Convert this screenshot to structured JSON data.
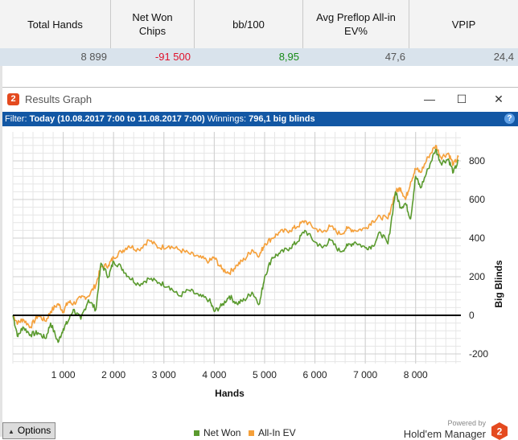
{
  "stats": {
    "headers": [
      "Total Hands",
      "Net Won\nChips",
      "bb/100",
      "Avg Preflop All-in\nEV%",
      "VPIP"
    ],
    "values": [
      "8 899",
      "-91 500",
      "8,95",
      "47,6",
      "24,4"
    ]
  },
  "window": {
    "title": "Results Graph",
    "controls": {
      "minimize": "—",
      "maximize": "☐",
      "close": "✕"
    }
  },
  "filter": {
    "label": "Filter:",
    "value": "Today (10.08.2017 7:00 to 11.08.2017 7:00)",
    "winnings_label": "Winnings:",
    "winnings_value": "796,1 big blinds",
    "help": "?"
  },
  "footer": {
    "options_label": "Options",
    "powered_by": "Powered by",
    "brand": "Hold'em Manager",
    "logo_text": "2"
  },
  "colors": {
    "net_won": "#5a9a2e",
    "all_in_ev": "#f5a03a",
    "filter_bar": "#1257a4",
    "zero_line": "#000000"
  },
  "chart_data": {
    "type": "line",
    "xlabel": "Hands",
    "ylabel": "Big Blinds",
    "xlim": [
      0,
      8899
    ],
    "ylim": [
      -250,
      950
    ],
    "x_ticks": [
      1000,
      2000,
      3000,
      4000,
      5000,
      6000,
      7000,
      8000
    ],
    "x_tick_labels": [
      "1 000",
      "2 000",
      "3 000",
      "4 000",
      "5 000",
      "6 000",
      "7 000",
      "8 000"
    ],
    "y_ticks": [
      -200,
      0,
      200,
      400,
      600,
      800
    ],
    "y_tick_labels": [
      "-200",
      "0",
      "200",
      "400",
      "600",
      "800"
    ],
    "grid": true,
    "legend_position": "bottom-center",
    "series": [
      {
        "name": "Net Won",
        "x": [
          0,
          100,
          200,
          350,
          500,
          650,
          750,
          900,
          1000,
          1100,
          1200,
          1350,
          1500,
          1650,
          1750,
          1900,
          2000,
          2150,
          2300,
          2500,
          2700,
          2900,
          3100,
          3300,
          3500,
          3700,
          3900,
          4000,
          4150,
          4300,
          4450,
          4600,
          4750,
          4900,
          5000,
          5150,
          5300,
          5500,
          5650,
          5800,
          6000,
          6150,
          6300,
          6500,
          6650,
          6800,
          7000,
          7150,
          7300,
          7450,
          7600,
          7700,
          7800,
          7900,
          8000,
          8100,
          8250,
          8400,
          8500,
          8650,
          8750,
          8850
        ],
        "values": [
          0,
          -110,
          -60,
          -100,
          -90,
          -120,
          -40,
          -140,
          -70,
          -30,
          30,
          -20,
          80,
          30,
          270,
          200,
          280,
          250,
          200,
          160,
          190,
          170,
          150,
          100,
          130,
          100,
          80,
          20,
          50,
          100,
          60,
          80,
          120,
          60,
          200,
          300,
          320,
          350,
          380,
          440,
          380,
          350,
          390,
          330,
          360,
          380,
          350,
          360,
          430,
          370,
          640,
          560,
          580,
          500,
          720,
          660,
          760,
          860,
          790,
          810,
          740,
          800
        ]
      },
      {
        "name": "All-In EV",
        "x": [
          0,
          100,
          200,
          350,
          500,
          650,
          750,
          900,
          1000,
          1100,
          1200,
          1350,
          1500,
          1650,
          1750,
          1900,
          2000,
          2150,
          2300,
          2500,
          2700,
          2900,
          3100,
          3300,
          3500,
          3700,
          3900,
          4000,
          4150,
          4300,
          4450,
          4600,
          4750,
          4900,
          5000,
          5150,
          5300,
          5500,
          5650,
          5800,
          6000,
          6150,
          6300,
          6500,
          6650,
          6800,
          7000,
          7150,
          7300,
          7450,
          7600,
          7700,
          7800,
          7900,
          8000,
          8100,
          8250,
          8400,
          8500,
          8650,
          8750,
          8850
        ],
        "values": [
          0,
          -40,
          -20,
          -60,
          0,
          -30,
          20,
          60,
          20,
          70,
          60,
          90,
          100,
          160,
          250,
          260,
          300,
          330,
          360,
          340,
          390,
          350,
          360,
          340,
          320,
          300,
          280,
          300,
          240,
          220,
          260,
          290,
          340,
          310,
          370,
          400,
          430,
          440,
          460,
          490,
          450,
          430,
          460,
          420,
          450,
          440,
          450,
          490,
          510,
          500,
          640,
          660,
          600,
          690,
          760,
          740,
          820,
          880,
          820,
          840,
          780,
          820
        ]
      }
    ]
  }
}
